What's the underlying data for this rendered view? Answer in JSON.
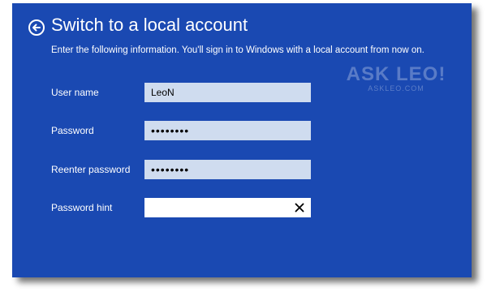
{
  "header": {
    "title": "Switch to a local account",
    "subtitle": "Enter the following information. You'll sign in to Windows with a local account from now on.",
    "back_icon": "back-arrow-circle-icon"
  },
  "watermark": {
    "main": "ASK LEO!",
    "sub": "ASKLEO.COM"
  },
  "form": {
    "username_label": "User name",
    "username_value": "LeoN",
    "password_label": "Password",
    "password_value": "••••••••",
    "reenter_label": "Reenter password",
    "reenter_value": "••••••••",
    "hint_label": "Password hint",
    "hint_value": "",
    "clear_icon": "close-icon"
  },
  "colors": {
    "background": "#1a49b2",
    "field_filled": "#cfdcef",
    "field_active": "#ffffff",
    "text": "#ffffff"
  }
}
